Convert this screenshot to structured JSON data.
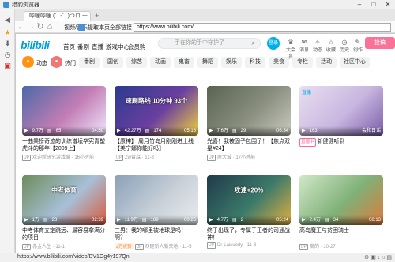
{
  "window": {
    "title": "猎豹浏览器",
    "minimize": "–",
    "maximize": "□",
    "close": "✕"
  },
  "tabs": [
    {
      "label": "哔哩哔哩 (゜-゜)つロ 干杯~"
    }
  ],
  "toolbar": {
    "links": [
      "视频/音乐",
      "提取本页全部链接",
      "解析本页视频"
    ],
    "url": "https://www.bilibili.com/"
  },
  "site": {
    "logo": "bilibili",
    "nav": [
      "首页",
      "番剧",
      "直播",
      "游戏中心",
      "会员购",
      "漫画",
      "赛事"
    ],
    "search_placeholder": "手在你的手中守护了",
    "login": "登录",
    "right_icons": [
      {
        "icon": "crown-icon",
        "label": "大会员"
      },
      {
        "icon": "message-icon",
        "label": "消息"
      },
      {
        "icon": "star-icon",
        "label": "动态"
      },
      {
        "icon": "history-icon",
        "label": "收藏"
      },
      {
        "icon": "clock-icon",
        "label": "历史"
      },
      {
        "icon": "bulb-icon",
        "label": "创作"
      }
    ],
    "upload": "投稿"
  },
  "channels": {
    "dynamic": "动态",
    "hot": "热门",
    "pills": [
      "番剧",
      "国创",
      "综艺",
      "动画",
      "鬼畜",
      "舞蹈",
      "娱乐",
      "科技",
      "美食",
      "专栏",
      "活动",
      "社区中心"
    ]
  },
  "videos": [
    {
      "title": "一曲乘榜奇迹的训练谱坛华宪青塑虎斗的那年【2009上】",
      "views": "9.7万",
      "comments": "65",
      "duration": "04:50",
      "up": "欢迎新研究游戏事",
      "date": "16小时前",
      "colors": [
        "#4b6aa8",
        "#c37db5",
        "#f0e6ff"
      ]
    },
    {
      "title": "【原神】 周月竹岛月刚刚进上线【美宁娜你能好吗】",
      "views": "42.27万",
      "comments": "174",
      "duration": "05:16",
      "up": "Zw曾森",
      "date": "11-8",
      "colors": [
        "#2a3b8f",
        "#6b3fa0",
        "#f2d23c"
      ],
      "overlay": "速刷路线 10分钟 93个"
    },
    {
      "title": "光喜！我被固子包围了！【焦点双星#24】",
      "views": "7.6万",
      "comments": "29",
      "duration": "06:34",
      "up": "原大城",
      "date": "17小时前",
      "colors": [
        "#5a6350",
        "#8a8f80",
        "#c9cbc0"
      ]
    },
    {
      "title": "新健健听到",
      "views": "163",
      "comments": "",
      "duration": "",
      "up": "直播",
      "date": "会和日谣",
      "live": true,
      "live_label": "直播",
      "live_badge": "直播中",
      "colors": [
        "#e8dff0",
        "#c9b6e0",
        "#7a5ea8"
      ]
    },
    {
      "title": "中考体育立定跳远、最容易拿满分的项目",
      "views": "1万",
      "comments": "23",
      "duration": "02:39",
      "up": "赤金人生",
      "date": "11-1",
      "colors": [
        "#6d8c5a",
        "#a8c0d8",
        "#d85a3a"
      ],
      "overlay": "中考体育"
    },
    {
      "title": "三男：我的哪里被地球是吗！ 啊？",
      "views": "11.9万",
      "comments": "189",
      "duration": "00:25",
      "up": "欢迎新人新天地",
      "date": "11-5",
      "hot": "2万点赞",
      "colors": [
        "#8aa0b8",
        "#c8d0d8",
        "#e8ecef"
      ]
    },
    {
      "title": "终于出现了，专属于王者的司通战神！",
      "views": "4.7万",
      "comments": "2",
      "duration": "05:24",
      "up": "Dr-Laisuerly",
      "date": "11-8",
      "colors": [
        "#1f3a4a",
        "#3c7a6a",
        "#e0b040"
      ],
      "overlay": "攻速+20%"
    },
    {
      "title": "高岛魔王与贫困骑士",
      "views": "2.4万",
      "comments": "34",
      "duration": "08:13",
      "up": "奥的",
      "date": "10-27",
      "colors": [
        "#d0e8c8",
        "#80b078",
        "#e07a3a"
      ]
    }
  ],
  "status": {
    "url": "https://www.bilibili.com/video/BV1Gg4y197Qn"
  }
}
